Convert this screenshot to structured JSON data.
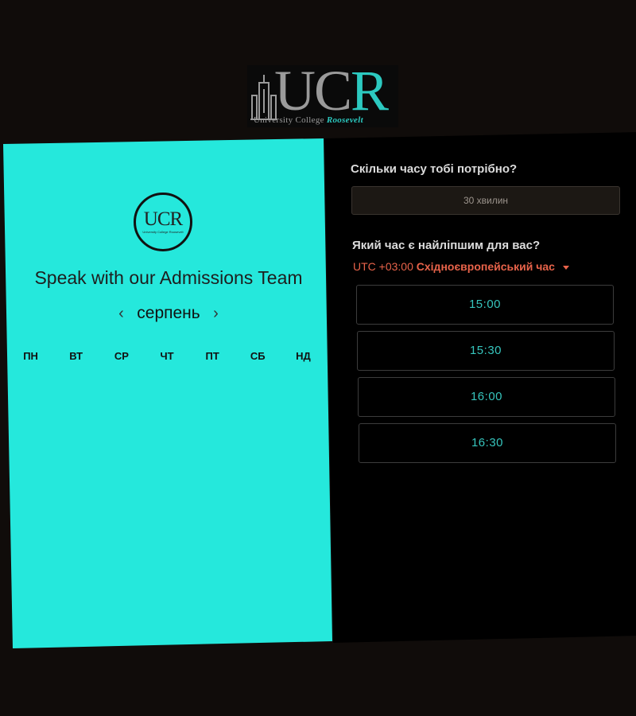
{
  "logo": {
    "uc": "UC",
    "r": "R",
    "sub_plain": "University College ",
    "sub_accent": "Roosevelt"
  },
  "calendar": {
    "logo_mini": "UCR",
    "logo_mini_sub": "University College Roosevelt",
    "title": "Speak with our Admissions Team",
    "month": "серпень",
    "prev_icon": "‹",
    "next_icon": "›",
    "weekdays": [
      "ПН",
      "ВТ",
      "СР",
      "ЧТ",
      "ПТ",
      "СБ",
      "НД"
    ]
  },
  "booking": {
    "duration_question": "Скільки часу тобі потрібно?",
    "duration_value": "30 хвилин",
    "time_question": "Який час є найліпшим для вас?",
    "timezone_offset": "UTC +03:00",
    "timezone_name": "Східноєвропейський час",
    "slots": [
      "15:00",
      "15:30",
      "16:00",
      "16:30"
    ]
  },
  "colors": {
    "accent_teal": "#25e8dc",
    "slot_text": "#36c5bd",
    "timezone": "#e8634a",
    "background": "#100c0a"
  }
}
